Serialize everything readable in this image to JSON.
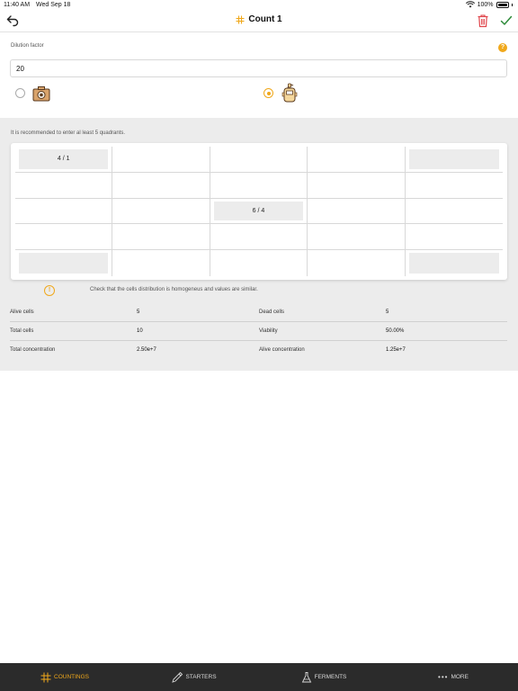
{
  "status": {
    "time": "11:40 AM",
    "date": "Wed Sep 18",
    "battery": "100%"
  },
  "nav": {
    "title": "Count 1"
  },
  "form": {
    "dilution_label": "Dilution factor",
    "dilution_value": "20",
    "input_method": "counter"
  },
  "hint": "It is recommended to enter al least 5 quadrants.",
  "grid": {
    "rows": [
      [
        {
          "value": "4 / 1",
          "filled": true
        },
        {
          "value": "",
          "filled": false
        },
        {
          "value": "",
          "filled": false
        },
        {
          "value": "",
          "filled": false
        },
        {
          "value": "",
          "filled": true
        }
      ],
      [
        {
          "value": "",
          "filled": false
        },
        {
          "value": "",
          "filled": false
        },
        {
          "value": "",
          "filled": false
        },
        {
          "value": "",
          "filled": false
        },
        {
          "value": "",
          "filled": false
        }
      ],
      [
        {
          "value": "",
          "filled": false
        },
        {
          "value": "",
          "filled": false
        },
        {
          "value": "6 / 4",
          "filled": true
        },
        {
          "value": "",
          "filled": false
        },
        {
          "value": "",
          "filled": false
        }
      ],
      [
        {
          "value": "",
          "filled": false
        },
        {
          "value": "",
          "filled": false
        },
        {
          "value": "",
          "filled": false
        },
        {
          "value": "",
          "filled": false
        },
        {
          "value": "",
          "filled": false
        }
      ],
      [
        {
          "value": "",
          "filled": true
        },
        {
          "value": "",
          "filled": false
        },
        {
          "value": "",
          "filled": false
        },
        {
          "value": "",
          "filled": false
        },
        {
          "value": "",
          "filled": true
        }
      ]
    ]
  },
  "warning": "Check that the cells distribution is homogeneus and values are similar.",
  "results": {
    "alive_label": "Alive cells",
    "alive_value": "5",
    "dead_label": "Dead cells",
    "dead_value": "5",
    "total_label": "Total cells",
    "total_value": "10",
    "viability_label": "Viability",
    "viability_value": "50.00%",
    "total_conc_label": "Total concentration",
    "total_conc_value": "2.50e+7",
    "alive_conc_label": "Alive concentration",
    "alive_conc_value": "1.25e+7"
  },
  "tabs": {
    "countings": "COUNTINGS",
    "starters": "STARTERS",
    "ferments": "FERMENTS",
    "more": "MORE",
    "active": "countings"
  },
  "colors": {
    "accent": "#f0a81b",
    "danger": "#e0454b",
    "confirm": "#2e8b3a",
    "tabbar": "#2b2b2b"
  }
}
